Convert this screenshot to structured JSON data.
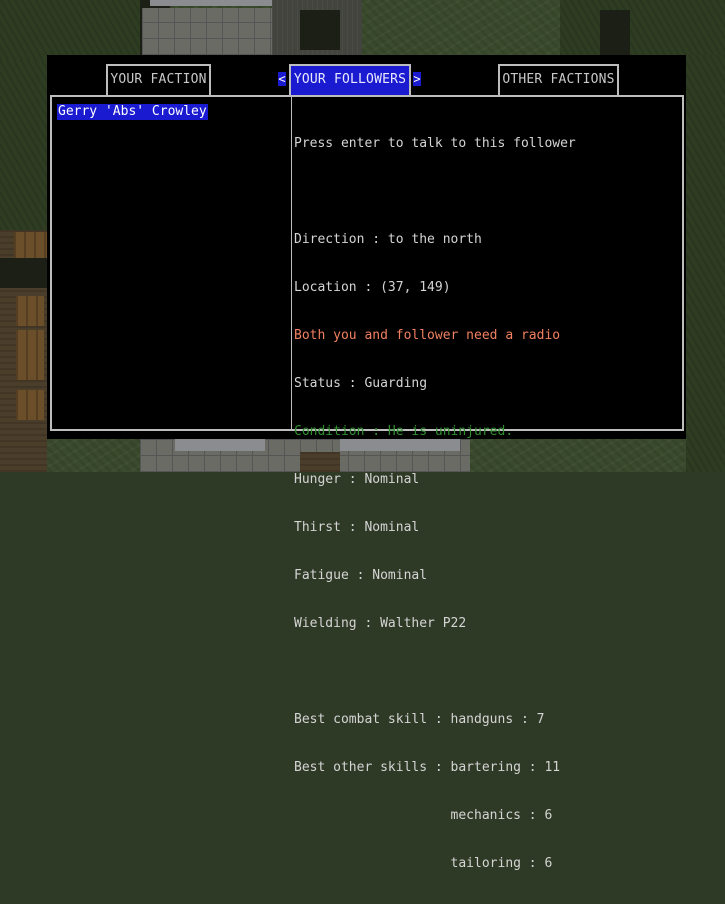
{
  "tabs": [
    {
      "label": "YOUR FACTION",
      "active": false
    },
    {
      "label": "YOUR FOLLOWERS",
      "active": true
    },
    {
      "label": "OTHER FACTIONS",
      "active": false
    }
  ],
  "arrows": {
    "left": "<",
    "right": ">"
  },
  "followers": [
    {
      "name": "Gerry 'Abs' Crowley",
      "selected": true
    }
  ],
  "details": {
    "prompt": "Press enter to talk to this follower",
    "direction": "Direction : to the north",
    "location": "Location : (37, 149)",
    "radio": "Both you and follower need a radio",
    "status": "Status : Guarding",
    "condition": "Condition : He is uninjured.",
    "hunger": "Hunger : Nominal",
    "thirst": "Thirst : Nominal",
    "fatigue": "Fatigue : Nominal",
    "wielding": "Wielding : Walther P22",
    "best_combat": "Best combat skill : handguns : 7",
    "best_other_1": "Best other skills : bartering : 11",
    "best_other_2": "                    mechanics : 6",
    "best_other_3": "                    tailoring : 6"
  },
  "colors": {
    "highlight": "#1a1ad0",
    "warning_text": "#f08060",
    "condition_text": "#2f8f2f",
    "border": "#bdbdbd"
  }
}
